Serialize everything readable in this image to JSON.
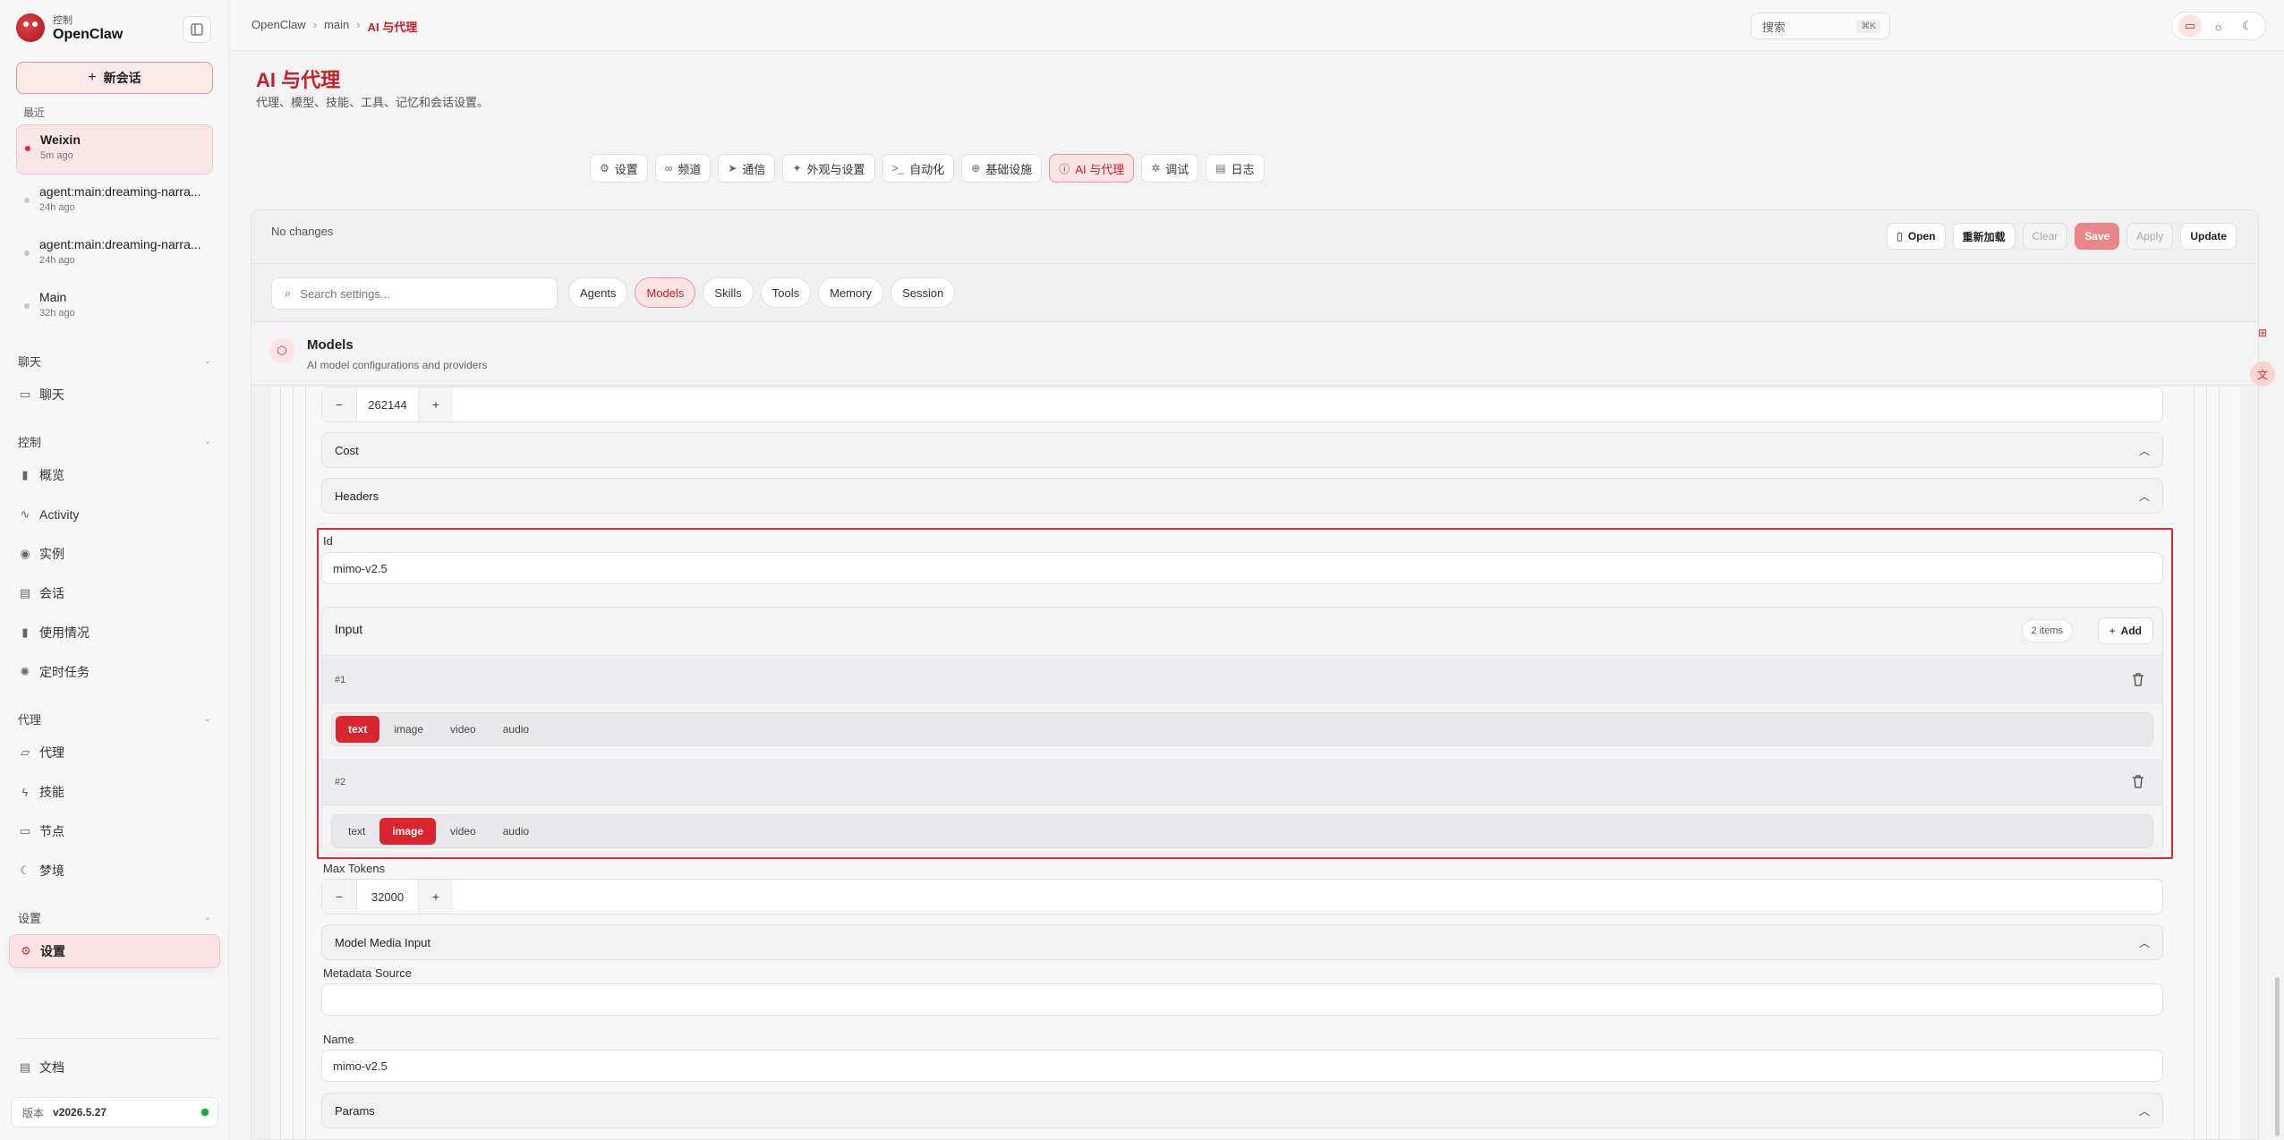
{
  "brand": {
    "sub": "控制",
    "name": "OpenClaw"
  },
  "sidebar": {
    "new_chat": "新会话",
    "recent_label": "最近",
    "recent": [
      {
        "title": "Weixin",
        "time": "5m ago"
      },
      {
        "title": "agent:main:dreaming-narra...",
        "time": "24h ago"
      },
      {
        "title": "agent:main:dreaming-narra...",
        "time": "24h ago"
      },
      {
        "title": "Main",
        "time": "32h ago"
      }
    ],
    "groups": {
      "chat": {
        "label": "聊天",
        "items": [
          "聊天"
        ]
      },
      "control": {
        "label": "控制",
        "items": [
          "概览",
          "Activity",
          "实例",
          "会话",
          "使用情况",
          "定时任务"
        ]
      },
      "agent": {
        "label": "代理",
        "items": [
          "代理",
          "技能",
          "节点",
          "梦境"
        ]
      },
      "settings": {
        "label": "设置",
        "items": [
          "设置"
        ]
      }
    },
    "docs": "文档",
    "version_label": "版本",
    "version": "v2026.5.27"
  },
  "topbar": {
    "breadcrumb": [
      "OpenClaw",
      "main",
      "AI 与代理"
    ],
    "search_placeholder": "搜索",
    "search_kbd": "⌘K"
  },
  "page": {
    "title": "AI 与代理",
    "subtitle": "代理、模型、技能、工具、记忆和会话设置。",
    "tabs": [
      "设置",
      "频道",
      "通信",
      "外观与设置",
      "自动化",
      "基础设施",
      "AI 与代理",
      "调试",
      "日志"
    ]
  },
  "panel": {
    "status": "No changes",
    "actions": [
      "Open",
      "重新加载",
      "Clear",
      "Save",
      "Apply",
      "Update"
    ],
    "search_placeholder": "Search settings...",
    "chips": [
      "Agents",
      "Models",
      "Skills",
      "Tools",
      "Memory",
      "Session"
    ],
    "section": {
      "name": "Models",
      "desc": "AI model configurations and providers"
    }
  },
  "form": {
    "context_value": "262144",
    "cost_label": "Cost",
    "headers_label": "Headers",
    "id_label": "Id",
    "id_value": "mimo-v2.5",
    "input": {
      "label": "Input",
      "count": "2 items",
      "add": "Add",
      "items": [
        {
          "num": "#1",
          "options": [
            "text",
            "image",
            "video",
            "audio"
          ],
          "selected": "text"
        },
        {
          "num": "#2",
          "options": [
            "text",
            "image",
            "video",
            "audio"
          ],
          "selected": "image"
        }
      ]
    },
    "max_tokens_label": "Max Tokens",
    "max_tokens_value": "32000",
    "media_input_label": "Model Media Input",
    "metadata_label": "Metadata Source",
    "metadata_value": "",
    "name_label": "Name",
    "name_value": "mimo-v2.5",
    "params_label": "Params"
  },
  "colors": {
    "accent": "#d62c35",
    "accent_soft": "#fbe4e5"
  }
}
